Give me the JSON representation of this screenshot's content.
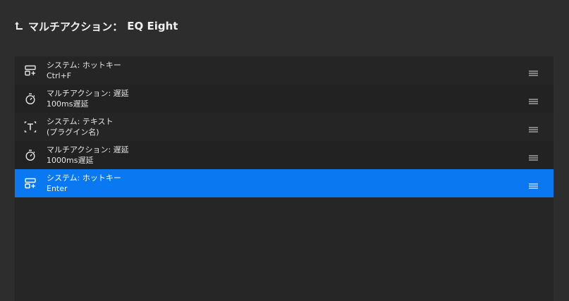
{
  "header": {
    "title_label": "マルチアクション：",
    "title_value": "EQ Eight"
  },
  "icons": {
    "back": "return-arrow-icon",
    "hotkey": "hotkey-icon",
    "delay": "stopwatch-icon",
    "text": "text-icon",
    "drag": "drag-handle-icon"
  },
  "colors": {
    "background": "#2d2d2d",
    "panel": "#262626",
    "selected": "#0a78f0"
  },
  "actions": [
    {
      "title": "システム: ホットキー",
      "subtitle": "Ctrl+F",
      "icon": "hotkey-icon",
      "selected": false
    },
    {
      "title": "マルチアクション: 遅延",
      "subtitle": "100ms遅延",
      "icon": "stopwatch-icon",
      "selected": false
    },
    {
      "title": "システム: テキスト",
      "subtitle": "(プラグイン名)",
      "icon": "text-icon",
      "selected": false
    },
    {
      "title": "マルチアクション: 遅延",
      "subtitle": "1000ms遅延",
      "icon": "stopwatch-icon",
      "selected": false
    },
    {
      "title": "システム: ホットキー",
      "subtitle": "Enter",
      "icon": "hotkey-icon",
      "selected": true
    }
  ]
}
